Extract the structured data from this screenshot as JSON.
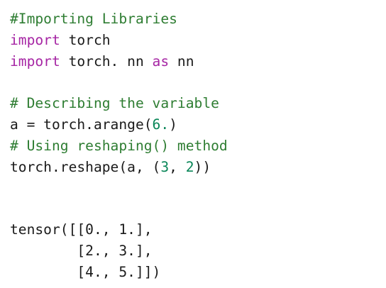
{
  "code": {
    "comment_importing": "#Importing Libraries",
    "line_import_torch": {
      "kw": "import",
      "rest": " torch"
    },
    "line_import_nn": {
      "kw1": "import",
      "mid": " torch. nn ",
      "kw2": "as",
      "rest": " nn"
    },
    "comment_describing": "# Describing the variable",
    "line_arange": {
      "prefix": "a = torch.arange(",
      "num": "6.",
      "suffix": ")"
    },
    "comment_reshaping": "# Using reshaping() method",
    "line_reshape": {
      "prefix": "torch.reshape(a, (",
      "num1": "3",
      "sep": ", ",
      "num2": "2",
      "suffix": "))"
    }
  },
  "output": {
    "lines": [
      "tensor([[0., 1.],",
      "        [2., 3.],",
      "        [4., 5.]])"
    ]
  },
  "colors": {
    "comment": "#2e7d32",
    "keyword": "#a626a4",
    "number": "#098658",
    "text": "#1a1a1a",
    "background": "#ffffff"
  }
}
